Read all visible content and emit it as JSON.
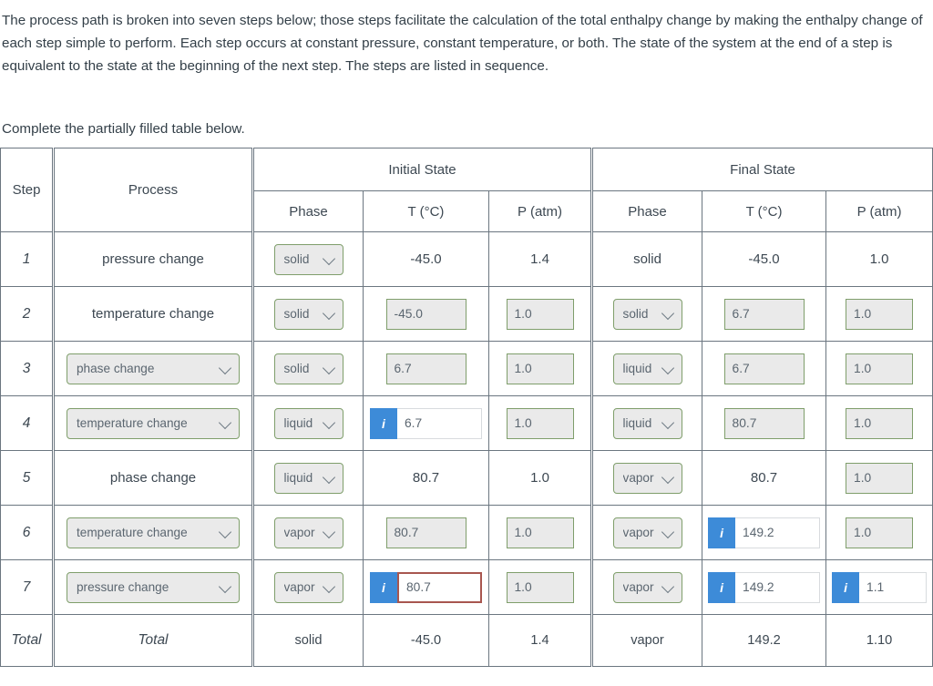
{
  "intro": {
    "paragraph": "The process path is broken into seven steps below; those steps facilitate the calculation of the total enthalpy change by making the enthalpy change of each step simple to perform. Each step occurs at constant pressure, constant temperature, or both. The state of the system at the end of a step is equivalent to the state at the beginning of the next step. The steps are listed in sequence.",
    "instruction": "Complete the partially filled table below."
  },
  "table": {
    "headers": {
      "step": "Step",
      "process": "Process",
      "initial_state": "Initial State",
      "final_state": "Final State",
      "phase": "Phase",
      "temperature": "T (°C)",
      "pressure": "P (atm)"
    },
    "icons": {
      "info": "info-icon",
      "chevron": "chevron-down-icon"
    },
    "colors": {
      "info_badge": "#3d8bd8",
      "control_border": "#7f9e6b",
      "control_fill": "#eaeaea",
      "focus_border": "#a8564f",
      "table_border": "#6b7680",
      "text": "#3d4852"
    },
    "select_options": {
      "phase": [
        "solid",
        "liquid",
        "vapor"
      ],
      "process": [
        "pressure change",
        "temperature change",
        "phase change"
      ]
    },
    "rows": [
      {
        "step": "1",
        "process": {
          "value": "pressure change",
          "control": "text"
        },
        "initial": {
          "phase": {
            "value": "solid",
            "control": "select"
          },
          "temp": {
            "value": "-45.0",
            "control": "text"
          },
          "pres": {
            "value": "1.4",
            "control": "text"
          }
        },
        "final": {
          "phase": {
            "value": "solid",
            "control": "text"
          },
          "temp": {
            "value": "-45.0",
            "control": "text"
          },
          "pres": {
            "value": "1.0",
            "control": "text"
          }
        }
      },
      {
        "step": "2",
        "process": {
          "value": "temperature change",
          "control": "text"
        },
        "initial": {
          "phase": {
            "value": "solid",
            "control": "select"
          },
          "temp": {
            "value": "-45.0",
            "control": "input"
          },
          "pres": {
            "value": "1.0",
            "control": "input"
          }
        },
        "final": {
          "phase": {
            "value": "solid",
            "control": "select"
          },
          "temp": {
            "value": "6.7",
            "control": "input"
          },
          "pres": {
            "value": "1.0",
            "control": "input"
          }
        }
      },
      {
        "step": "3",
        "process": {
          "value": "phase change",
          "control": "select"
        },
        "initial": {
          "phase": {
            "value": "solid",
            "control": "select"
          },
          "temp": {
            "value": "6.7",
            "control": "input"
          },
          "pres": {
            "value": "1.0",
            "control": "input"
          }
        },
        "final": {
          "phase": {
            "value": "liquid",
            "control": "select"
          },
          "temp": {
            "value": "6.7",
            "control": "input"
          },
          "pres": {
            "value": "1.0",
            "control": "input"
          }
        }
      },
      {
        "step": "4",
        "process": {
          "value": "temperature change",
          "control": "select"
        },
        "initial": {
          "phase": {
            "value": "liquid",
            "control": "select"
          },
          "temp": {
            "value": "6.7",
            "control": "input-info"
          },
          "pres": {
            "value": "1.0",
            "control": "input"
          }
        },
        "final": {
          "phase": {
            "value": "liquid",
            "control": "select"
          },
          "temp": {
            "value": "80.7",
            "control": "input"
          },
          "pres": {
            "value": "1.0",
            "control": "input"
          }
        }
      },
      {
        "step": "5",
        "process": {
          "value": "phase change",
          "control": "text"
        },
        "initial": {
          "phase": {
            "value": "liquid",
            "control": "select"
          },
          "temp": {
            "value": "80.7",
            "control": "text"
          },
          "pres": {
            "value": "1.0",
            "control": "text"
          }
        },
        "final": {
          "phase": {
            "value": "vapor",
            "control": "select"
          },
          "temp": {
            "value": "80.7",
            "control": "text"
          },
          "pres": {
            "value": "1.0",
            "control": "input"
          }
        }
      },
      {
        "step": "6",
        "process": {
          "value": "temperature change",
          "control": "select"
        },
        "initial": {
          "phase": {
            "value": "vapor",
            "control": "select"
          },
          "temp": {
            "value": "80.7",
            "control": "input"
          },
          "pres": {
            "value": "1.0",
            "control": "input"
          }
        },
        "final": {
          "phase": {
            "value": "vapor",
            "control": "select"
          },
          "temp": {
            "value": "149.2",
            "control": "input-info"
          },
          "pres": {
            "value": "1.0",
            "control": "input"
          }
        }
      },
      {
        "step": "7",
        "process": {
          "value": "pressure change",
          "control": "select"
        },
        "initial": {
          "phase": {
            "value": "vapor",
            "control": "select"
          },
          "temp": {
            "value": "80.7",
            "control": "input-info-focused"
          },
          "pres": {
            "value": "1.0",
            "control": "input"
          }
        },
        "final": {
          "phase": {
            "value": "vapor",
            "control": "select-white"
          },
          "temp": {
            "value": "149.2",
            "control": "input-info"
          },
          "pres": {
            "value": "1.1",
            "control": "input-info"
          }
        }
      }
    ],
    "total": {
      "step": "Total",
      "process": "Total",
      "initial": {
        "phase": "solid",
        "temp": "-45.0",
        "pres": "1.4"
      },
      "final": {
        "phase": "vapor",
        "temp": "149.2",
        "pres": "1.10"
      }
    }
  }
}
